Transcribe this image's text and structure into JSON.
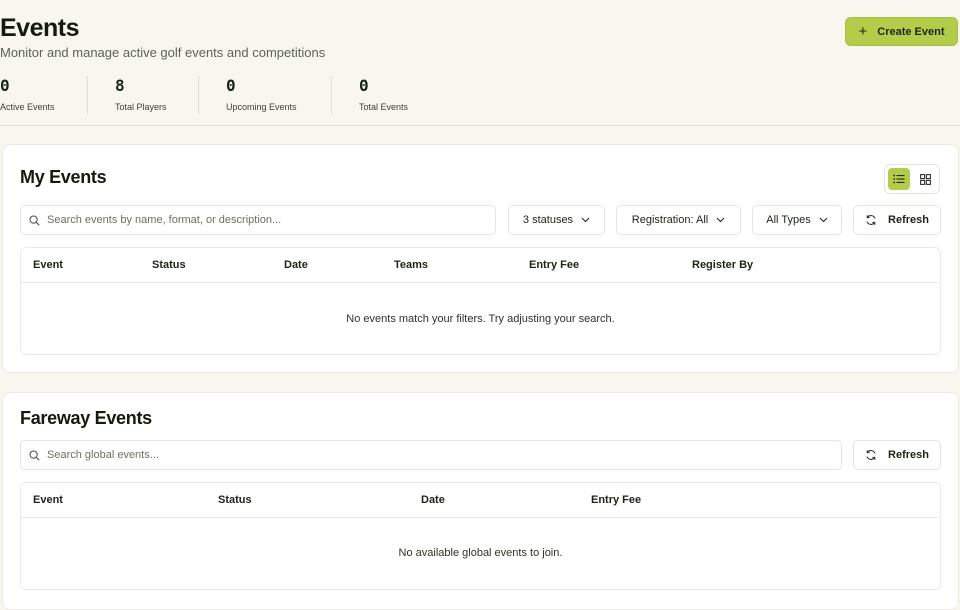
{
  "header": {
    "title": "Events",
    "subtitle": "Monitor and manage active golf events and competitions",
    "create_label": "Create Event"
  },
  "stats": [
    {
      "value": "0",
      "label": "Active Events"
    },
    {
      "value": "8",
      "label": "Total Players"
    },
    {
      "value": "0",
      "label": "Upcoming Events"
    },
    {
      "value": "0",
      "label": "Total Events"
    }
  ],
  "my_events": {
    "title": "My Events",
    "search_placeholder": "Search events by name, format, or description...",
    "filters": {
      "status": "3 statuses",
      "registration": "Registration: All",
      "type": "All Types"
    },
    "refresh_label": "Refresh",
    "columns": [
      "Event",
      "Status",
      "Date",
      "Teams",
      "Entry Fee",
      "Register By"
    ],
    "empty_message": "No events match your filters. Try adjusting your search.",
    "view_mode": "list"
  },
  "fareway_events": {
    "title": "Fareway Events",
    "search_placeholder": "Search global events...",
    "refresh_label": "Refresh",
    "columns": [
      "Event",
      "Status",
      "Date",
      "Entry Fee"
    ],
    "empty_message": "No available global events to join."
  },
  "colors": {
    "accent": "#b3cd4a",
    "background": "#f7f6ef",
    "text": "#1c2418"
  }
}
